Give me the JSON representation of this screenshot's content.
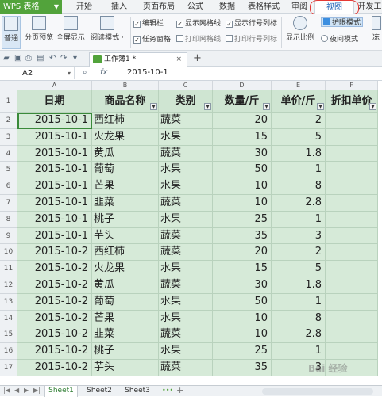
{
  "app": {
    "name": "WPS 表格",
    "tabs": [
      "开始",
      "插入",
      "页面布局",
      "公式",
      "数据",
      "表格样式",
      "审阅",
      "视图",
      "开发工"
    ],
    "active_tab": "视图"
  },
  "ribbon": {
    "buttons": [
      "普通",
      "分页预览",
      "全屏显示",
      "阅读模式 ·",
      "显示比例",
      "护眼模式",
      "夜间模式",
      "冻"
    ],
    "checks": [
      {
        "label": "编辑栏",
        "checked": true
      },
      {
        "label": "任务窗格",
        "checked": true
      },
      {
        "label": "显示网格线",
        "checked": true
      },
      {
        "label": "打印网格线",
        "checked": false
      },
      {
        "label": "显示行号列标",
        "checked": true
      },
      {
        "label": "打印行号列标",
        "checked": false
      }
    ]
  },
  "doc": {
    "tab_label": "工作簿1 *",
    "close": "×",
    "new": "+"
  },
  "formula_bar": {
    "cell_ref": "A2",
    "fx": "fx",
    "value": "2015-10-1"
  },
  "columns": [
    "A",
    "B",
    "C",
    "D",
    "E",
    "F"
  ],
  "headers": [
    "日期",
    "商品名称",
    "类别",
    "数量/斤",
    "单价/斤",
    "折扣单价"
  ],
  "rows": [
    {
      "n": "2",
      "date": "2015-10-1",
      "name": "西红柿",
      "cat": "蔬菜",
      "qty": "20",
      "price": "2"
    },
    {
      "n": "3",
      "date": "2015-10-1",
      "name": "火龙果",
      "cat": "水果",
      "qty": "15",
      "price": "5"
    },
    {
      "n": "4",
      "date": "2015-10-1",
      "name": "黄瓜",
      "cat": "蔬菜",
      "qty": "30",
      "price": "1.8"
    },
    {
      "n": "5",
      "date": "2015-10-1",
      "name": "葡萄",
      "cat": "水果",
      "qty": "50",
      "price": "1"
    },
    {
      "n": "6",
      "date": "2015-10-1",
      "name": "芒果",
      "cat": "水果",
      "qty": "10",
      "price": "8"
    },
    {
      "n": "7",
      "date": "2015-10-1",
      "name": "韭菜",
      "cat": "蔬菜",
      "qty": "10",
      "price": "2.8"
    },
    {
      "n": "8",
      "date": "2015-10-1",
      "name": "桃子",
      "cat": "水果",
      "qty": "25",
      "price": "1"
    },
    {
      "n": "9",
      "date": "2015-10-1",
      "name": "芋头",
      "cat": "蔬菜",
      "qty": "35",
      "price": "3"
    },
    {
      "n": "10",
      "date": "2015-10-2",
      "name": "西红柿",
      "cat": "蔬菜",
      "qty": "20",
      "price": "2"
    },
    {
      "n": "11",
      "date": "2015-10-2",
      "name": "火龙果",
      "cat": "水果",
      "qty": "15",
      "price": "5"
    },
    {
      "n": "12",
      "date": "2015-10-2",
      "name": "黄瓜",
      "cat": "蔬菜",
      "qty": "30",
      "price": "1.8"
    },
    {
      "n": "13",
      "date": "2015-10-2",
      "name": "葡萄",
      "cat": "水果",
      "qty": "50",
      "price": "1"
    },
    {
      "n": "14",
      "date": "2015-10-2",
      "name": "芒果",
      "cat": "水果",
      "qty": "10",
      "price": "8"
    },
    {
      "n": "15",
      "date": "2015-10-2",
      "name": "韭菜",
      "cat": "蔬菜",
      "qty": "10",
      "price": "2.8"
    },
    {
      "n": "16",
      "date": "2015-10-2",
      "name": "桃子",
      "cat": "水果",
      "qty": "25",
      "price": "1"
    },
    {
      "n": "17",
      "date": "2015-10-2",
      "name": "芋头",
      "cat": "蔬菜",
      "qty": "35",
      "price": "3"
    }
  ],
  "header_row_number": "1",
  "sheets": [
    "Sheet1",
    "Sheet2",
    "Sheet3"
  ],
  "active_sheet": "Sheet1",
  "watermark": "Bai 经验",
  "colors": {
    "accent": "#52a33b",
    "cell_fill": "#d6ead8",
    "highlight": "#e53935"
  }
}
